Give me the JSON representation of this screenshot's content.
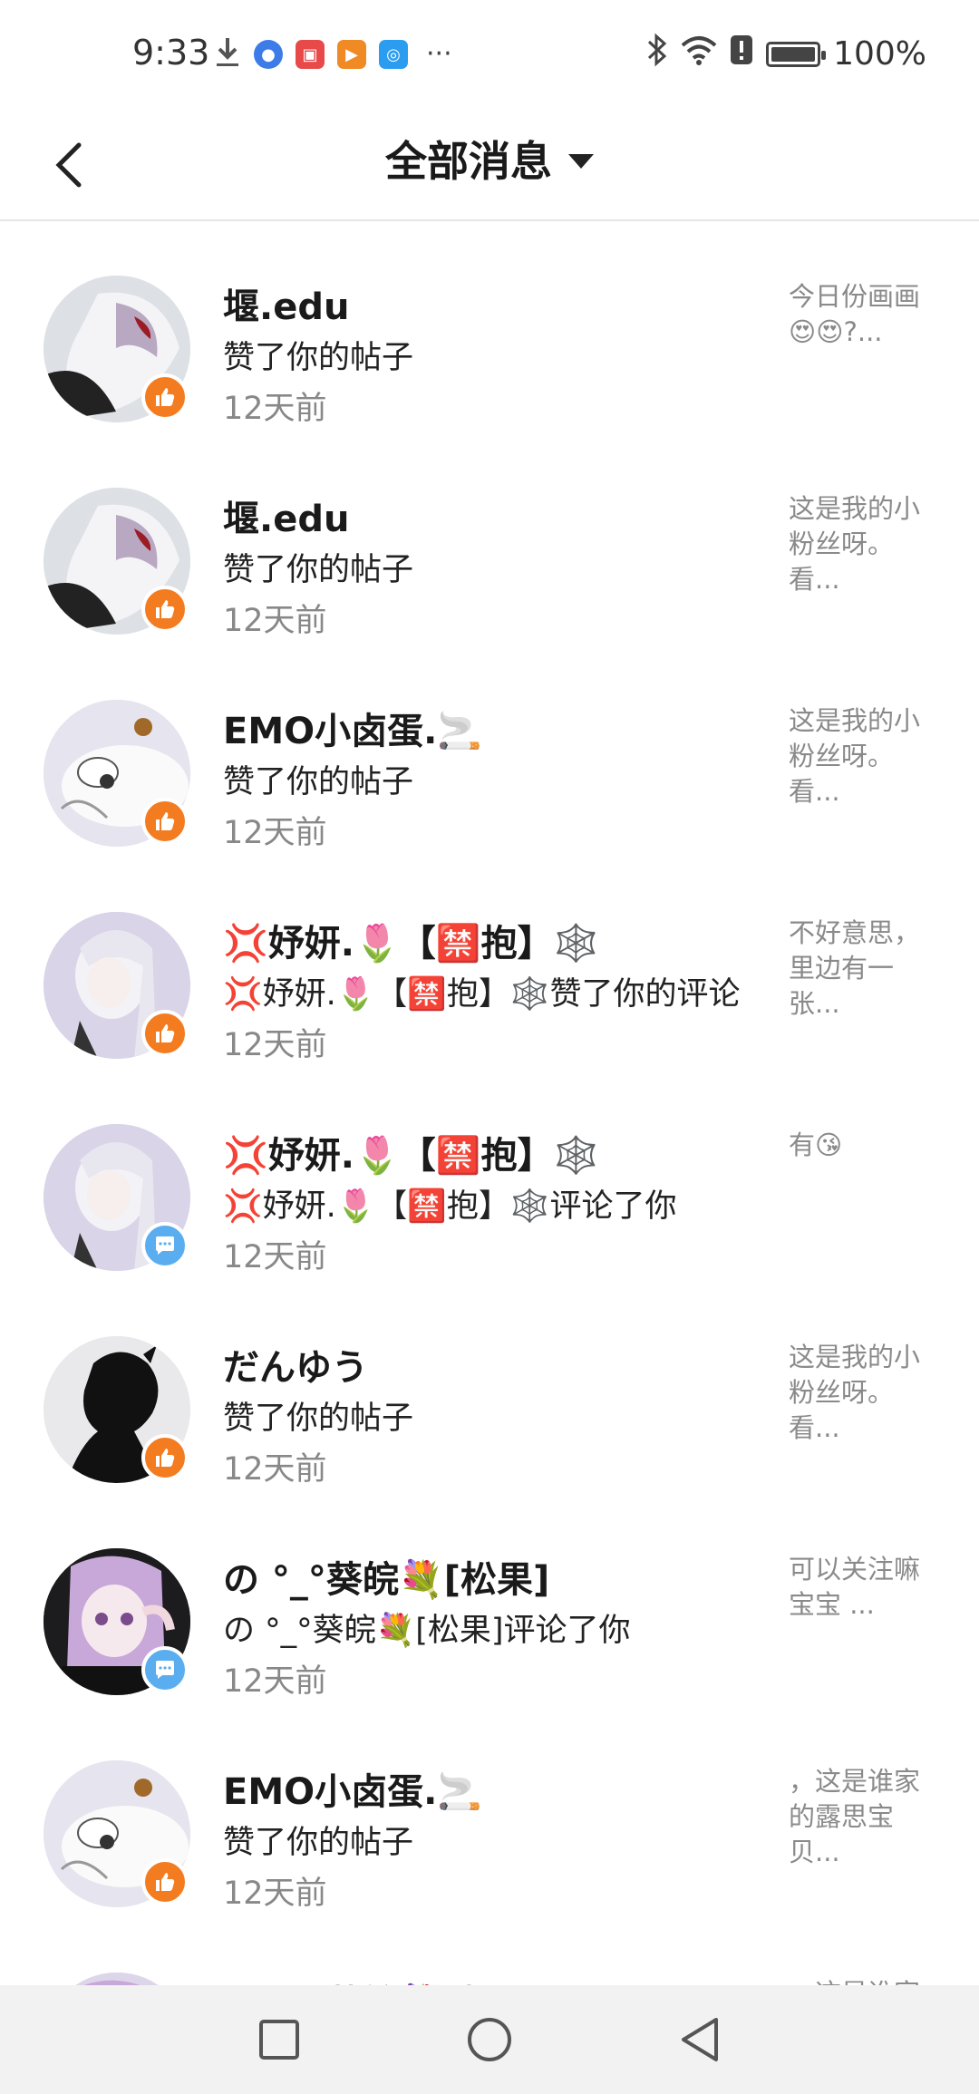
{
  "status_bar": {
    "time": "9:33",
    "battery": "100%",
    "icons": [
      "download-icon",
      "browser-icon",
      "reader-app-icon",
      "video-app-icon",
      "search-app-icon",
      "bluetooth-icon",
      "wifi-icon",
      "alert-icon",
      "battery-icon"
    ],
    "overflow": "···"
  },
  "header": {
    "title": "全部消息"
  },
  "notifications": [
    {
      "name": "堰.edu",
      "action": "赞了你的帖子",
      "time": "12天前",
      "preview": "今日份画画😍😍?...",
      "type": "like",
      "avatar_color": "#d9dde2"
    },
    {
      "name": "堰.edu",
      "action": "赞了你的帖子",
      "time": "12天前",
      "preview": "这是我的小粉丝呀。看...",
      "type": "like",
      "avatar_color": "#d9dde2"
    },
    {
      "name": "EMO小卤蛋.🚬",
      "action": "赞了你的帖子",
      "time": "12天前",
      "preview": "这是我的小粉丝呀。看...",
      "type": "like",
      "avatar_color": "#e3e0ea"
    },
    {
      "name": "💢妤妍.🌷【🈲抱】🕸️",
      "action": "💢妤妍.🌷【🈲抱】🕸️赞了你的评论",
      "time": "12天前",
      "preview": "不好意思，里边有一张...",
      "type": "like",
      "avatar_color": "#d8d2e6"
    },
    {
      "name": "💢妤妍.🌷【🈲抱】🕸️",
      "action": "💢妤妍.🌷【🈲抱】🕸️评论了你",
      "time": "12天前",
      "preview": "有😘",
      "type": "comment",
      "avatar_color": "#d8d2e6"
    },
    {
      "name": "だんゆう",
      "action": "赞了你的帖子",
      "time": "12天前",
      "preview": "这是我的小粉丝呀。看...",
      "type": "like",
      "avatar_color": "#e8e8e8"
    },
    {
      "name": "の °_°葵皖💐[松果]",
      "action": "の °_°葵皖💐[松果]评论了你",
      "time": "12天前",
      "preview": "可以关注嘛宝宝 ...",
      "type": "comment",
      "avatar_color": "#1b1b1b"
    },
    {
      "name": "EMO小卤蛋.🚬",
      "action": "赞了你的帖子",
      "time": "12天前",
      "preview": "，这是谁家的露思宝贝...",
      "type": "like",
      "avatar_color": "#e3e0ea"
    },
    {
      "name": "の °_°葵皖💐[松果]",
      "action": "",
      "time": "",
      "preview": "，这是谁家",
      "type": "comment",
      "avatar_color": "#d8d2e6"
    }
  ],
  "nav_bar": {
    "buttons": [
      "recents-icon",
      "home-icon",
      "back-icon"
    ]
  }
}
